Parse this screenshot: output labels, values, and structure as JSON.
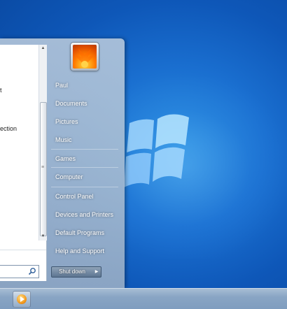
{
  "start_menu": {
    "left_pane": {
      "items": [
        {
          "label": "t"
        },
        {
          "label": "ection"
        }
      ]
    },
    "right_pane": {
      "user_name": "Paul",
      "items": [
        {
          "label": "Documents"
        },
        {
          "label": "Pictures"
        },
        {
          "label": "Music"
        },
        {
          "label": "Games"
        },
        {
          "label": "Computer"
        },
        {
          "label": "Control Panel"
        },
        {
          "label": "Devices and Printers"
        },
        {
          "label": "Default Programs"
        },
        {
          "label": "Help and Support"
        }
      ]
    },
    "shutdown": {
      "label": "Shut down"
    }
  },
  "taskbar": {
    "pinned": [
      {
        "icon": "media-player-icon"
      }
    ]
  },
  "icons": {
    "search": "search-icon",
    "windows_logo": "windows-logo-icon",
    "shutdown_options": "chevron-right-icon"
  }
}
